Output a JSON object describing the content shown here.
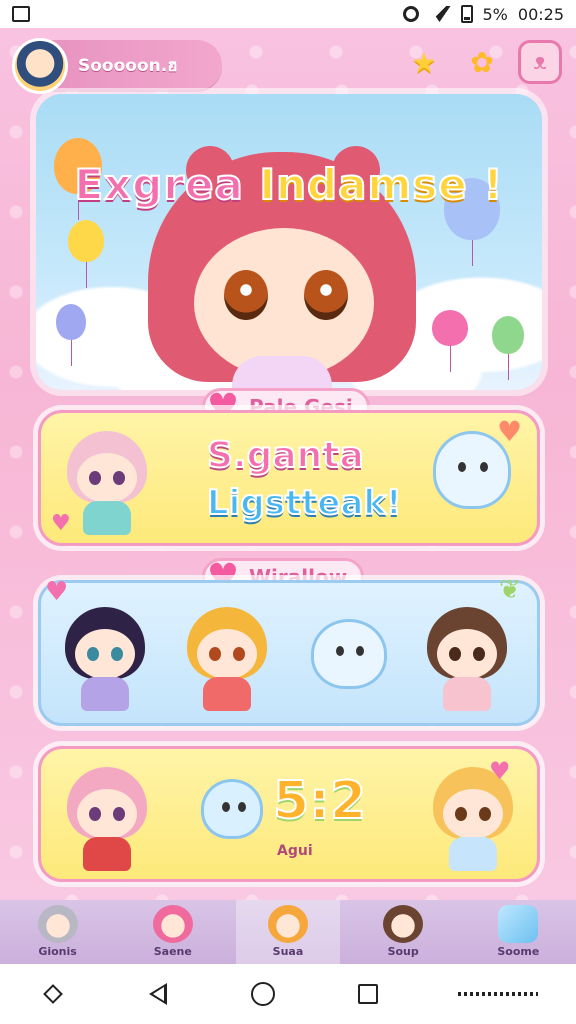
{
  "status_bar": {
    "battery_text": "5%",
    "time": "00:25"
  },
  "profile": {
    "name": "Sooooon.ฮ"
  },
  "hero": {
    "title_part1": "Exgrea",
    "title_part2": "Indamse !"
  },
  "section1": {
    "label": "Pale Gesi"
  },
  "card1": {
    "line1": "S.ganta",
    "line2": "Ligstteak!"
  },
  "section2": {
    "label": "Wirallow"
  },
  "card3": {
    "score": "5:2",
    "score_sub": "Agui"
  },
  "tabs": [
    {
      "label": "Gionis"
    },
    {
      "label": "Saene"
    },
    {
      "label": "Suaa"
    },
    {
      "label": "Soup"
    },
    {
      "label": "Soome"
    }
  ],
  "colors": {
    "accent_pink": "#f46fae",
    "accent_yellow": "#ffd43d",
    "card_yellow": "#fde97a",
    "card_blue": "#c4e4fb"
  }
}
